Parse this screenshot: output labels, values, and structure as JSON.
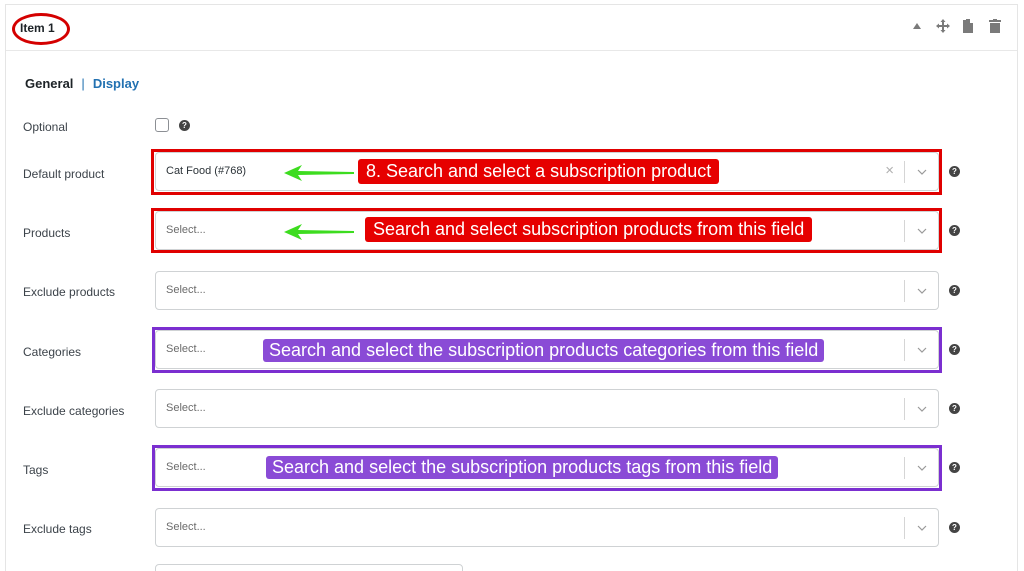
{
  "panel": {
    "title": "Item 1"
  },
  "header_icons": [
    "collapse-up-icon",
    "move-icon",
    "copy-icon",
    "trash-icon"
  ],
  "tabs": {
    "general": "General",
    "separator": "|",
    "display": "Display"
  },
  "fields": {
    "optional": {
      "label": "Optional"
    },
    "default_product": {
      "label": "Default product",
      "value": "Cat Food (#768)"
    },
    "products": {
      "label": "Products",
      "placeholder": "Select..."
    },
    "exclude_products": {
      "label": "Exclude products",
      "placeholder": "Select..."
    },
    "categories": {
      "label": "Categories",
      "placeholder": "Select..."
    },
    "exclude_categories": {
      "label": "Exclude categories",
      "placeholder": "Select..."
    },
    "tags": {
      "label": "Tags",
      "placeholder": "Select..."
    },
    "exclude_tags": {
      "label": "Exclude tags",
      "placeholder": "Select..."
    }
  },
  "annotations": {
    "default_product": "8. Search and select a subscription product",
    "products": "Search and select subscription products from this field",
    "categories": "Search and select the subscription products categories from this field",
    "tags": "Search and select the subscription products tags from this field"
  },
  "colors": {
    "annotation_red": "#e60000",
    "annotation_purple": "#8a4bd6",
    "arrow_green": "#3ddc1f",
    "link_blue": "#2271b1"
  }
}
